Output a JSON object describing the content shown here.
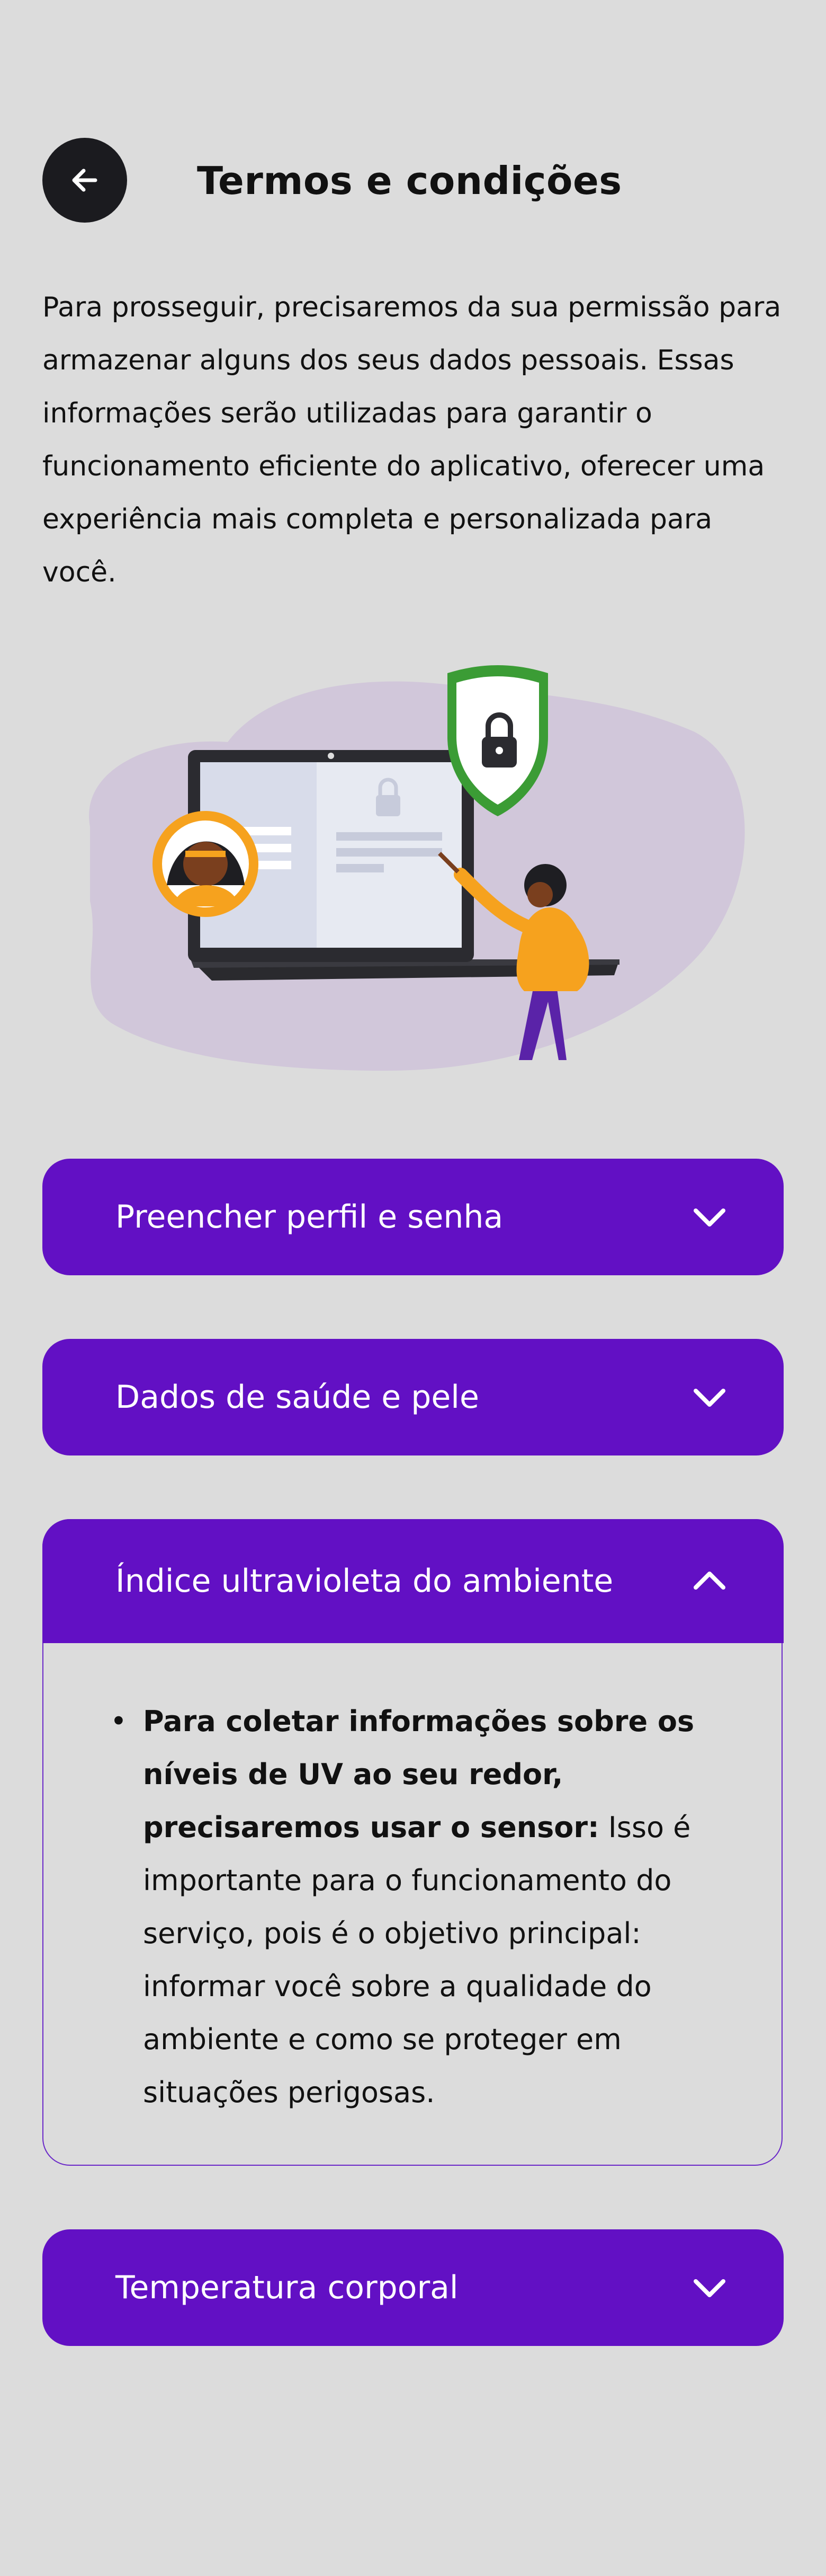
{
  "header": {
    "title": "Termos e condições",
    "back_icon": "arrow-left-icon"
  },
  "intro": {
    "text": "Para prosseguir, precisaremos da sua permissão para armazenar alguns dos seus dados pessoais. Essas informações serão utilizadas para garantir o funcionamento eficiente do aplicativo, oferecer uma experiência mais completa e personalizada para você."
  },
  "illustration": {
    "icon": "privacy-illustration"
  },
  "sections": [
    {
      "label": "Preencher perfil e senha",
      "expanded": false,
      "icon": "chevron-down-icon"
    },
    {
      "label": "Dados de saúde e pele",
      "expanded": false,
      "icon": "chevron-down-icon"
    },
    {
      "label": "Índice ultravioleta do ambiente",
      "expanded": true,
      "icon": "chevron-up-icon",
      "body_bold": "Para coletar informações sobre os níveis de UV ao seu redor, precisaremos usar o sensor:",
      "body_text": " Isso é importante para o funcionamento do serviço, pois é o objetivo principal: informar você sobre a qualidade do ambiente e como se proteger em situações perigosas."
    },
    {
      "label": "Temperatura corporal",
      "expanded": false,
      "icon": "chevron-down-icon"
    }
  ],
  "colors": {
    "background": "#dcdcdc",
    "accent": "#6210c4",
    "back_button": "#1b1b1f"
  }
}
